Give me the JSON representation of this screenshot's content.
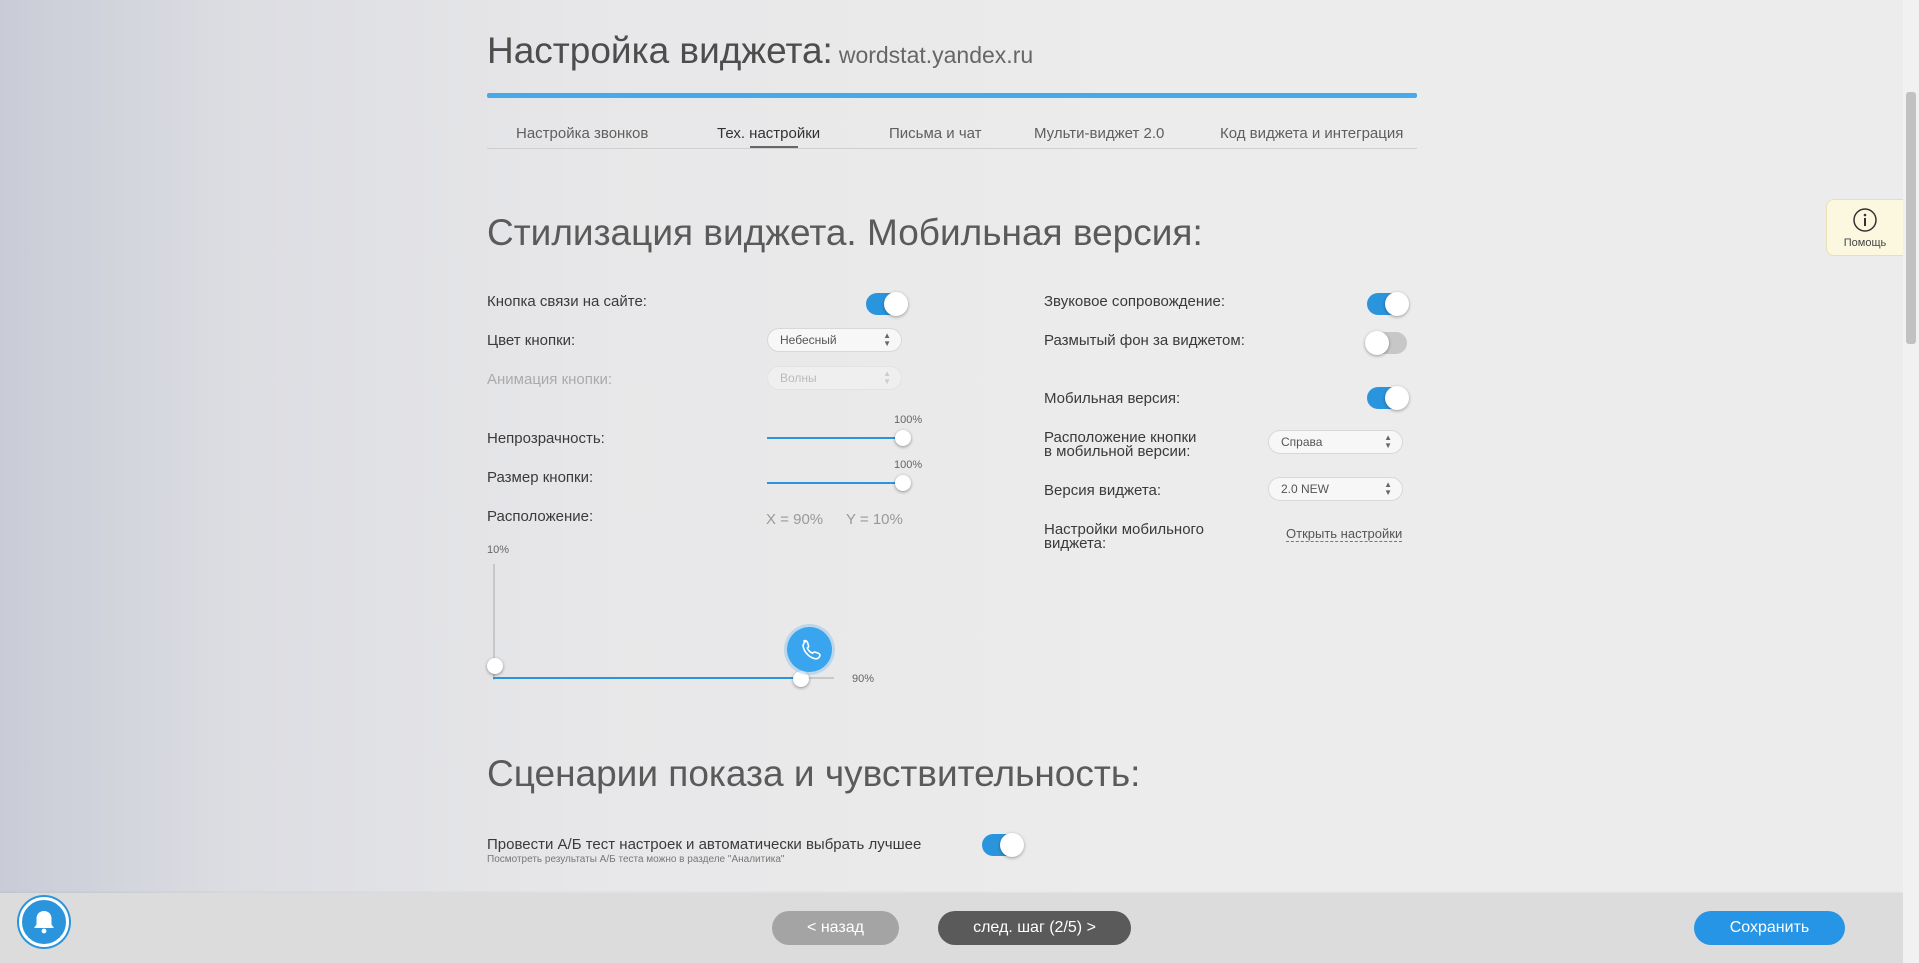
{
  "header": {
    "title": "Настройка виджета:",
    "domain": "wordstat.yandex.ru"
  },
  "tabs": [
    {
      "label": "Настройка звонков"
    },
    {
      "label": "Тех. настройки",
      "active": true
    },
    {
      "label": "Письма и чат"
    },
    {
      "label": "Мульти-виджет 2.0"
    },
    {
      "label": "Код виджета и интеграция"
    }
  ],
  "styling": {
    "title": "Стилизация виджета. Мобильная версия:",
    "button_on_site": {
      "label": "Кнопка связи на сайте:",
      "enabled": true
    },
    "button_color": {
      "label": "Цвет кнопки:",
      "value": "Небесный"
    },
    "button_animation": {
      "label": "Анимация кнопки:",
      "value": "Волны",
      "disabled": true
    },
    "opacity": {
      "label": "Непрозрачность:",
      "value": "100%",
      "percent": 100
    },
    "button_size": {
      "label": "Размер кнопки:",
      "value": "100%",
      "percent": 100
    },
    "position": {
      "label": "Расположение:",
      "x_text": "X = 90%",
      "y_text": "Y = 10%",
      "x_percent": 90,
      "y_percent": 10,
      "x_label": "90%",
      "y_label": "10%"
    },
    "sound": {
      "label": "Звуковое сопровождение:",
      "enabled": true
    },
    "blur_bg": {
      "label": "Размытый фон за виджетом:",
      "enabled": false
    },
    "mobile_version": {
      "label": "Мобильная версия:",
      "enabled": true
    },
    "mobile_button_position": {
      "label_line1": "Расположение кнопки",
      "label_line2": "в мобильной версии:",
      "value": "Справа"
    },
    "widget_version": {
      "label": "Версия виджета:",
      "value": "2.0 NEW"
    },
    "mobile_settings": {
      "label_line1": "Настройки мобильного",
      "label_line2": "виджета:",
      "link": "Открыть настройки"
    }
  },
  "scenarios": {
    "title": "Сценарии показа и чувствительность:",
    "ab_test": {
      "label": "Провести А/Б тест настроек и автоматически выбрать лучшее",
      "hint": "Посмотреть результаты А/Б теста можно в разделе \"Аналитика\"",
      "enabled": true
    }
  },
  "help": {
    "label": "Помощь"
  },
  "footer": {
    "back": "< назад",
    "next": "след. шаг (2/5) >",
    "save": "Сохранить"
  },
  "colors": {
    "accent": "#2a95dd",
    "save": "#2695e5",
    "help_bg": "#fcf8df"
  }
}
